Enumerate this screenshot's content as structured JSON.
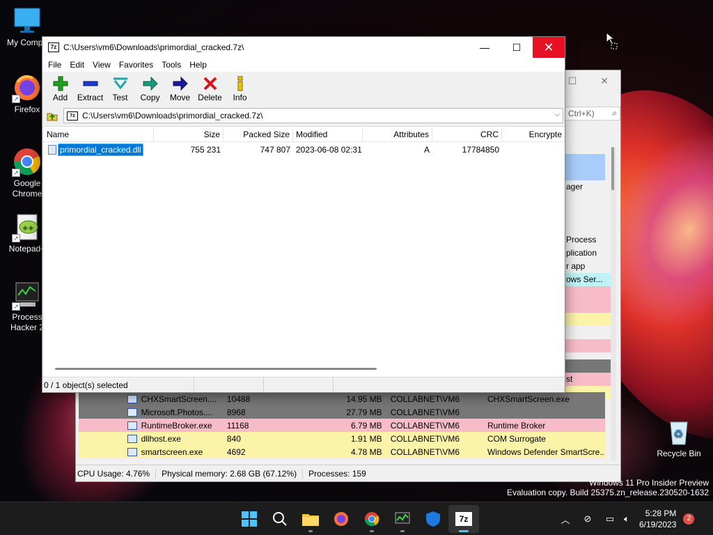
{
  "desktop": {
    "icons": [
      {
        "label": "My Compu",
        "icon": "monitor-icon"
      },
      {
        "label": "Firefox",
        "icon": "firefox-icon"
      },
      {
        "label": "Google\nChrome",
        "icon": "chrome-icon"
      },
      {
        "label": "Notepad+",
        "icon": "notepad-plus-icon"
      },
      {
        "label": "Process\nHacker 2",
        "icon": "process-hacker-icon"
      },
      {
        "label": "Recycle Bin",
        "icon": "recycle-bin-icon"
      }
    ]
  },
  "background_window": {
    "search_placeholder": "Ctrl+K)",
    "side_fragments": [
      "ager",
      "",
      "",
      "",
      "Process",
      "plication",
      "r app",
      "ows Ser...",
      "",
      "",
      "",
      "",
      "",
      "",
      "",
      "",
      "",
      "",
      "",
      "",
      "st"
    ],
    "rows": [
      {
        "name": "CHXSmartScreen....",
        "pid": "10488",
        "mem": "14.95 MB",
        "user": "COLLABNET\\VM6",
        "desc": "CHXSmartScreen.exe",
        "color": "#777777"
      },
      {
        "name": "Microsoft.Photos....",
        "pid": "8968",
        "mem": "27.79 MB",
        "user": "COLLABNET\\VM6",
        "desc": "",
        "color": "#777777"
      },
      {
        "name": "RuntimeBroker.exe",
        "pid": "11168",
        "mem": "6.79 MB",
        "user": "COLLABNET\\VM6",
        "desc": "Runtime Broker",
        "color": "#f7bcc8"
      },
      {
        "name": "dllhost.exe",
        "pid": "840",
        "mem": "1.91 MB",
        "user": "COLLABNET\\VM6",
        "desc": "COM Surrogate",
        "color": "#fbf3a8"
      },
      {
        "name": "smartscreen.exe",
        "pid": "4692",
        "mem": "4.78 MB",
        "user": "COLLABNET\\VM6",
        "desc": "Windows Defender SmartScre...",
        "color": "#fbf3a8"
      }
    ],
    "status": {
      "cpu": "CPU Usage: 4.76%",
      "memory": "Physical memory: 2.68 GB (67.12%)",
      "processes": "Processes: 159"
    }
  },
  "zip_window": {
    "title": "C:\\Users\\vm6\\Downloads\\primordial_cracked.7z\\",
    "menu": [
      "File",
      "Edit",
      "View",
      "Favorites",
      "Tools",
      "Help"
    ],
    "toolbar": [
      {
        "label": "Add",
        "icon": "add-icon"
      },
      {
        "label": "Extract",
        "icon": "extract-icon"
      },
      {
        "label": "Test",
        "icon": "test-icon"
      },
      {
        "label": "Copy",
        "icon": "copy-icon"
      },
      {
        "label": "Move",
        "icon": "move-icon"
      },
      {
        "label": "Delete",
        "icon": "delete-icon"
      },
      {
        "label": "Info",
        "icon": "info-icon"
      }
    ],
    "address": "C:\\Users\\vm6\\Downloads\\primordial_cracked.7z\\",
    "columns": [
      "Name",
      "Size",
      "Packed Size",
      "Modified",
      "Attributes",
      "CRC",
      "Encrypte"
    ],
    "files": [
      {
        "name": "primordial_cracked.dll",
        "size": "755 231",
        "packed": "747 807",
        "modified": "2023-06-08 02:31",
        "attributes": "A",
        "crc": "17784850",
        "encrypted": ""
      }
    ],
    "status": "0 / 1 object(s) selected"
  },
  "watermark": {
    "line1": "Windows 11 Pro Insider Preview",
    "line2": "Evaluation copy. Build 25375.zn_release.230520-1632"
  },
  "taskbar": {
    "apps": [
      "start-icon",
      "search-icon",
      "file-explorer-icon",
      "firefox-icon",
      "chrome-icon",
      "process-hacker-icon",
      "defender-icon",
      "7zip-icon"
    ],
    "active": "7zip-icon",
    "zip_label": "7z",
    "time": "5:28 PM",
    "date": "6/19/2023",
    "notifications": "2"
  },
  "colors": {
    "accent": "#0078d7",
    "close": "#e81123",
    "taskbar": "#1c1c1c"
  }
}
